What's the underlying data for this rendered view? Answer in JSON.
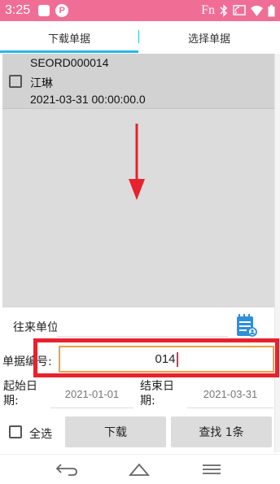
{
  "status_bar": {
    "time": "3:25",
    "p_label": "P",
    "fn_label": "Fn",
    "bg_color": "#f06e96"
  },
  "tabs": [
    {
      "label": "下载单据",
      "active": true
    },
    {
      "label": "选择单据",
      "active": false
    }
  ],
  "list": {
    "items": [
      {
        "code": "SEORD000014",
        "name": "江琳",
        "date": "2021-03-31 00:00:00.0",
        "checked": false
      }
    ]
  },
  "annotation": {
    "arrow_color": "#e8212e",
    "highlight_color": "#e8212e"
  },
  "form": {
    "partner_label": "往来单位:",
    "partner_value": "",
    "docno_label": "单据编号:",
    "docno_value": "014",
    "start_label": "起始日期:",
    "start_value": "2021-01-01",
    "end_label": "结束日期:",
    "end_value": "2021-03-31"
  },
  "actions": {
    "select_all": "全选",
    "download": "下载",
    "search": "查找 1条"
  },
  "icons": {
    "partner_picker": "address-book-icon",
    "nav_back": "back-icon",
    "nav_home": "home-icon",
    "nav_menu": "menu-icon"
  }
}
